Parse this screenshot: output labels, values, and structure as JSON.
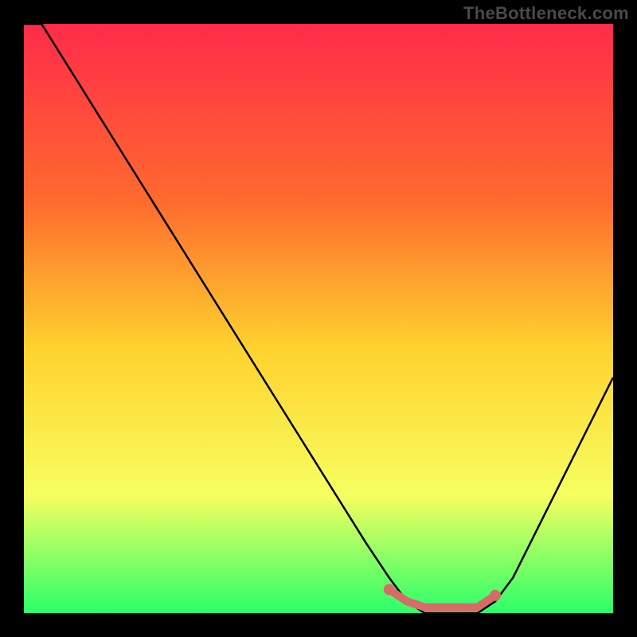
{
  "watermark": "TheBottleneck.com",
  "colors": {
    "background": "#000000",
    "gradient_top": "#ff2b4a",
    "gradient_mid1": "#ff6a2e",
    "gradient_mid2": "#ffd22e",
    "gradient_mid3": "#f6ff60",
    "gradient_bottom": "#2aff6a",
    "curve": "#000000",
    "accent_stroke": "#d86a6a",
    "accent_fill": "#d86a6a"
  },
  "chart_data": {
    "type": "line",
    "title": "",
    "xlabel": "",
    "ylabel": "",
    "xlim": [
      0,
      100
    ],
    "ylim": [
      0,
      100
    ],
    "series": [
      {
        "name": "bottleneck-curve",
        "x": [
          0,
          3,
          8,
          13,
          18,
          23,
          28,
          33,
          38,
          43,
          48,
          53,
          58,
          62,
          65,
          68,
          71,
          74,
          77,
          80,
          83,
          86,
          89,
          92,
          95,
          98,
          100
        ],
        "values": [
          100,
          100,
          92,
          84,
          76,
          68,
          60,
          52,
          44,
          36,
          28,
          20,
          12,
          6,
          2,
          0,
          0,
          0,
          0,
          2,
          6,
          12,
          18,
          24,
          30,
          36,
          40
        ]
      }
    ],
    "accent_segment": {
      "name": "optimal-range-marker",
      "x": [
        62,
        65,
        68,
        71,
        74,
        77,
        80
      ],
      "values": [
        4,
        2,
        1,
        1,
        1,
        1,
        3
      ]
    },
    "accent_dots": [
      {
        "x": 62,
        "y": 4
      },
      {
        "x": 80,
        "y": 3
      }
    ]
  }
}
